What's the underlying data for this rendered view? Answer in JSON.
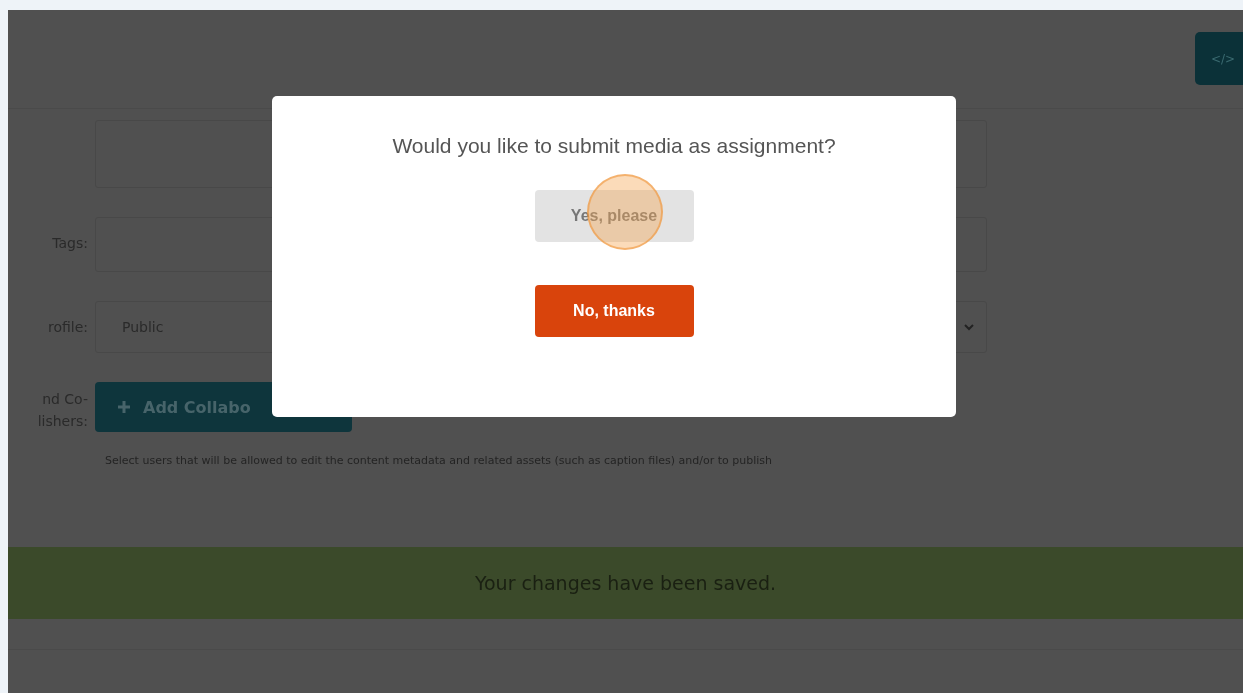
{
  "header": {
    "code_button": "</>"
  },
  "form": {
    "rows": [
      {
        "kind": "textarea",
        "label": ""
      },
      {
        "kind": "input",
        "label": "Tags:"
      },
      {
        "kind": "select",
        "label": "rofile:",
        "value": "Public"
      },
      {
        "kind": "button",
        "label_lines": [
          "nd Co-",
          "lishers:"
        ],
        "button": "Add Collabo",
        "help": "Select users that will be allowed to edit the content metadata and related assets (such as caption files) and/or to publish"
      }
    ]
  },
  "success_message": "Your changes have been saved.",
  "dialog": {
    "question": "Would you like to submit media as assignment?",
    "buttons": [
      {
        "label": "Yes, please",
        "kind": "secondary",
        "clicked": true
      },
      {
        "label": "No, thanks",
        "kind": "primary",
        "clicked": false
      }
    ]
  }
}
